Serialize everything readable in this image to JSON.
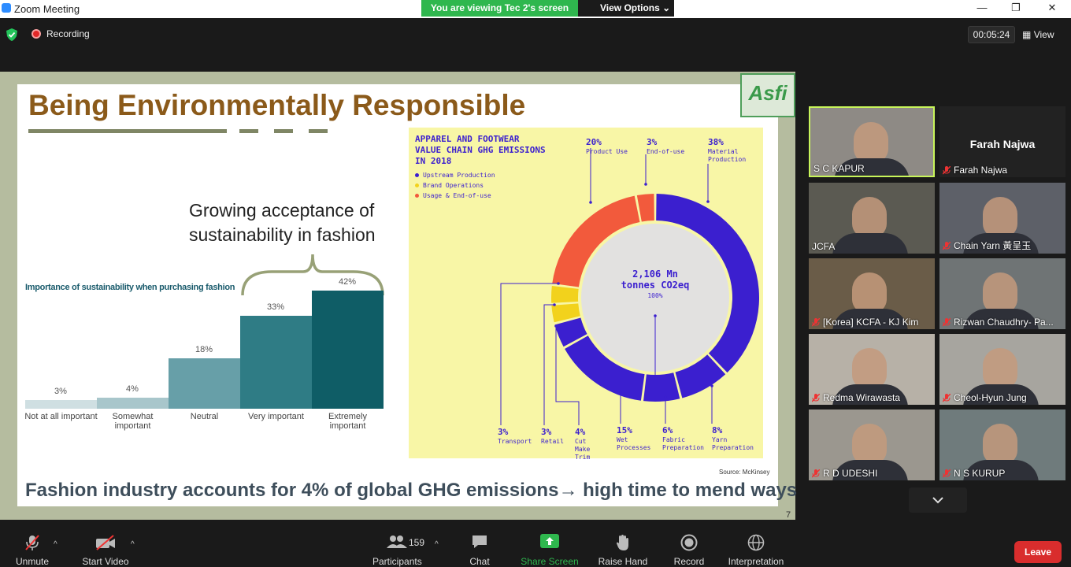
{
  "window": {
    "title": "Zoom Meeting",
    "minimize": "—",
    "maximize": "❐",
    "close": "✕"
  },
  "share_banner": {
    "text": "You are viewing Tec 2's screen",
    "options": "View Options"
  },
  "topbar": {
    "recording": "Recording",
    "timer": "00:05:24",
    "view": "View"
  },
  "slide": {
    "title": "Being Environmentally Responsible",
    "logo": "Asfi",
    "acceptance": [
      "Growing acceptance of",
      "sustainability in fashion"
    ],
    "bar_chart_title": "Importance of sustainability when purchasing fashion",
    "footer": "Fashion industry accounts for 4% of global GHG emissions→ high time to mend ways",
    "source": "Source: McKinsey",
    "page": "7",
    "panel": {
      "title": [
        "APPAREL AND FOOTWEAR",
        "VALUE CHAIN GHG EMISSIONS",
        "IN 2018"
      ],
      "legend": [
        "Upstream Production",
        "Brand Operations",
        "Usage & End-of-use"
      ],
      "center": [
        "2,106 Mn",
        "tonnes CO2eq",
        "100%"
      ],
      "labels": [
        {
          "pct": "20%",
          "text": [
            "Product Use"
          ]
        },
        {
          "pct": "3%",
          "text": [
            "End-of-use"
          ]
        },
        {
          "pct": "38%",
          "text": [
            "Material",
            "Production"
          ]
        },
        {
          "pct": "3%",
          "text": [
            "Transport"
          ]
        },
        {
          "pct": "3%",
          "text": [
            "Retail"
          ]
        },
        {
          "pct": "4%",
          "text": [
            "Cut",
            "Make",
            "Trim"
          ]
        },
        {
          "pct": "15%",
          "text": [
            "Wet",
            "Processes"
          ]
        },
        {
          "pct": "6%",
          "text": [
            "Fabric",
            "Preparation"
          ]
        },
        {
          "pct": "8%",
          "text": [
            "Yarn",
            "Preparation"
          ]
        }
      ]
    }
  },
  "chart_data": [
    {
      "type": "bar",
      "title": "Importance of sustainability when purchasing fashion",
      "categories": [
        "Not at all important",
        "Somewhat important",
        "Neutral",
        "Very important",
        "Extremely important"
      ],
      "values": [
        3,
        4,
        18,
        33,
        42
      ],
      "value_labels": [
        "3%",
        "4%",
        "18%",
        "33%",
        "42%"
      ],
      "colors": [
        "#cfdfe2",
        "#a8c6cb",
        "#679fa8",
        "#2f7c85",
        "#0f5d66"
      ],
      "ylim": [
        0,
        42
      ]
    },
    {
      "type": "pie",
      "title": "APPAREL AND FOOTWEAR VALUE CHAIN GHG EMISSIONS IN 2018",
      "categories": [
        "Material Production",
        "Yarn Preparation",
        "Fabric Preparation",
        "Wet Processes",
        "Cut Make Trim",
        "Retail",
        "Transport",
        "Product Use",
        "End-of-use"
      ],
      "values": [
        38,
        8,
        6,
        15,
        4,
        3,
        3,
        20,
        3
      ],
      "groups": [
        "Upstream Production",
        "Upstream Production",
        "Upstream Production",
        "Upstream Production",
        "Upstream Production",
        "Brand Operations",
        "Brand Operations",
        "Usage & End-of-use",
        "Usage & End-of-use"
      ],
      "group_colors": {
        "Upstream Production": "#3b1fcf",
        "Brand Operations": "#f2d21c",
        "Usage & End-of-use": "#f25a3c"
      }
    }
  ],
  "participants": [
    {
      "name": "S C KAPUR",
      "muted": false,
      "active": true
    },
    {
      "name": "Farah Najwa",
      "muted": true,
      "video": false
    },
    {
      "name": "JCFA",
      "muted": false
    },
    {
      "name": "Chain Yarn 黃呈玉",
      "muted": true
    },
    {
      "name": "[Korea] KCFA - KJ Kim",
      "muted": true
    },
    {
      "name": "Rizwan Chaudhry- Pa...",
      "muted": true
    },
    {
      "name": "Redma Wirawasta",
      "muted": true
    },
    {
      "name": "Cheol-Hyun Jung",
      "muted": true
    },
    {
      "name": "R D UDESHI",
      "muted": true
    },
    {
      "name": "N S KURUP",
      "muted": true
    }
  ],
  "toolbar": {
    "unmute": "Unmute",
    "start_video": "Start Video",
    "participants_count": "159",
    "participants": "Participants",
    "chat": "Chat",
    "share_screen": "Share Screen",
    "raise_hand": "Raise Hand",
    "record": "Record",
    "interpretation": "Interpretation",
    "leave": "Leave"
  }
}
